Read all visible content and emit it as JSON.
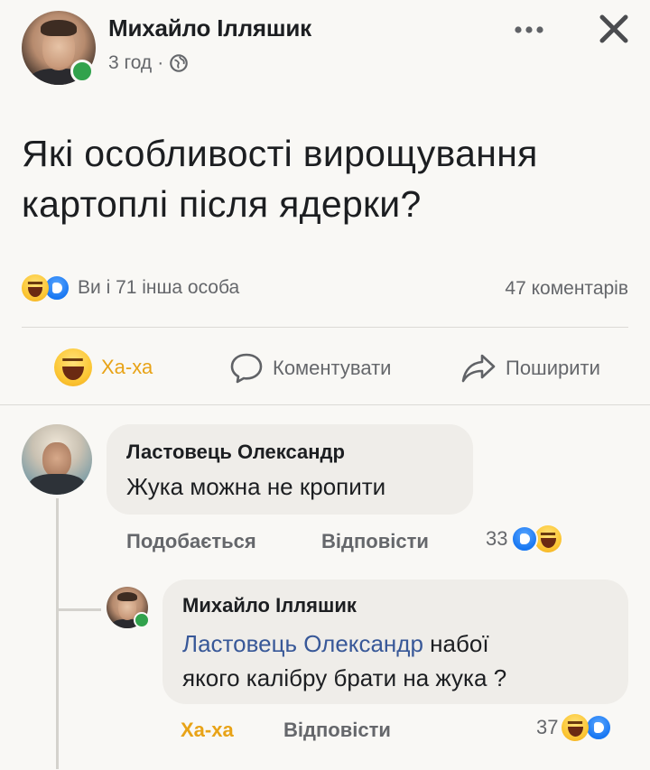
{
  "post": {
    "author": "Михайло Ілляшик",
    "time": "3 год",
    "separator": "·",
    "privacy_icon": "globe-icon",
    "text_line1": "Які особливості вирощування",
    "text_line2": "картоплі після ядерки?",
    "reactions_summary": "Ви і 71 інша особа",
    "comments_count": "47 коментарів"
  },
  "actions": {
    "haha": "Ха-ха",
    "comment": "Коментувати",
    "share": "Поширити"
  },
  "comments": [
    {
      "author": "Ластовець Олександр",
      "text": "Жука можна не кропити",
      "like_label": "Подобається",
      "reply_label": "Відповісти",
      "reaction_count": "33"
    },
    {
      "author": "Михайло Ілляшик",
      "mention": "Ластовець Олександр",
      "text_after_mention": " набої",
      "text_line2": "якого калібру брати на жука ?",
      "like_label": "Ха-ха",
      "reply_label": "Відповісти",
      "reaction_count": "37"
    }
  ],
  "colors": {
    "online": "#31a24c",
    "haha_active": "#e8a317",
    "mention": "#385898",
    "bubble": "#efede9"
  }
}
